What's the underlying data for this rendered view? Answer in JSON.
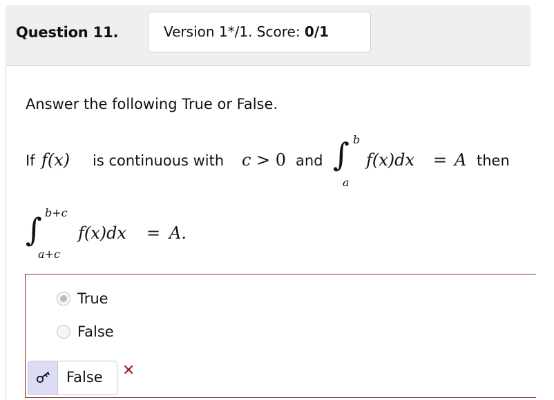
{
  "header": {
    "question_label": "Question 11.",
    "version_text": "Version 1*/1. Score: ",
    "score": "0/1"
  },
  "body": {
    "instruction": "Answer the following True or False.",
    "problem": {
      "t_if": "If",
      "m_fx": "f(x)",
      "t_continuous": "is continuous with",
      "m_c": "c",
      "m_gt": "> 0",
      "t_and": "and",
      "m_integral": "∫",
      "m_upper": "b",
      "m_lower": "a",
      "m_integrand": "f(x)dx",
      "m_eq": "=",
      "m_A": "A",
      "t_then": "then"
    },
    "second_integral": {
      "m_integral": "∫",
      "m_upper": "b+c",
      "m_lower": "a+c",
      "m_integrand": "f(x)dx",
      "m_eq": "=",
      "m_A": "A."
    }
  },
  "answer": {
    "options": [
      {
        "label": "True",
        "selected": true
      },
      {
        "label": "False",
        "selected": false
      }
    ],
    "response_value": "False",
    "key_icon": "key-icon",
    "result_icon": "cross-icon",
    "result_symbol": "✕",
    "colors": {
      "border": "#8b2a2a",
      "wrong": "#9b1c1c",
      "key_bg": "#dcdcf6"
    }
  }
}
